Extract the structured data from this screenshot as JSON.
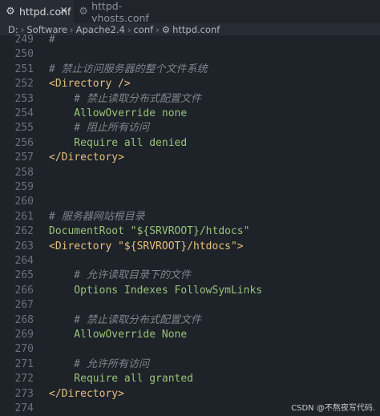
{
  "tabs": [
    {
      "label": "httpd.conf",
      "icon": "gear-icon",
      "active": true,
      "close": "×"
    },
    {
      "label": "httpd-vhosts.conf",
      "icon": "gear-icon",
      "active": false
    }
  ],
  "breadcrumb": {
    "parts": [
      "D:",
      "Software",
      "Apache2.4",
      "conf"
    ],
    "file": "httpd.conf",
    "separator": "›"
  },
  "editor": {
    "lines": [
      {
        "num": "249",
        "text": "#",
        "kind": "comment"
      },
      {
        "num": "250",
        "text": "",
        "kind": ""
      },
      {
        "num": "251",
        "text": "# 禁止访问服务器的整个文件系统",
        "kind": "comment"
      },
      {
        "num": "252",
        "text": "<Directory />",
        "kind": "tag"
      },
      {
        "num": "253",
        "text": "    # 禁止读取分布式配置文件",
        "kind": "comment"
      },
      {
        "num": "254",
        "text": "    AllowOverride none",
        "kind": "directive"
      },
      {
        "num": "255",
        "text": "    # 阻止所有访问",
        "kind": "comment"
      },
      {
        "num": "256",
        "text": "    Require all denied",
        "kind": "directive"
      },
      {
        "num": "257",
        "text": "</Directory>",
        "kind": "tag"
      },
      {
        "num": "258",
        "text": "",
        "kind": ""
      },
      {
        "num": "259",
        "text": "",
        "kind": ""
      },
      {
        "num": "260",
        "text": "",
        "kind": ""
      },
      {
        "num": "261",
        "text": "# 服务器网站根目录",
        "kind": "comment"
      },
      {
        "num": "262",
        "text": "DocumentRoot \"${SRVROOT}/htdocs\"",
        "kind": "string"
      },
      {
        "num": "263",
        "text": "<Directory \"${SRVROOT}/htdocs\">",
        "kind": "tag"
      },
      {
        "num": "264",
        "text": "",
        "kind": ""
      },
      {
        "num": "265",
        "text": "    # 允许读取目录下的文件",
        "kind": "comment"
      },
      {
        "num": "266",
        "text": "    Options Indexes FollowSymLinks",
        "kind": "directive"
      },
      {
        "num": "267",
        "text": "",
        "kind": ""
      },
      {
        "num": "268",
        "text": "    # 禁止读取分布式配置文件",
        "kind": "comment"
      },
      {
        "num": "269",
        "text": "    AllowOverride None",
        "kind": "directive"
      },
      {
        "num": "270",
        "text": "",
        "kind": ""
      },
      {
        "num": "271",
        "text": "    # 允许所有访问",
        "kind": "comment"
      },
      {
        "num": "272",
        "text": "    Require all granted",
        "kind": "directive"
      },
      {
        "num": "273",
        "text": "</Directory>",
        "kind": "tag"
      },
      {
        "num": "274",
        "text": "",
        "kind": ""
      }
    ]
  },
  "watermark": "CSDN @不熬夜写代码.",
  "colors": {
    "background": "#1e2229",
    "comment": "#7f848e",
    "tag": "#e5c07b",
    "directive": "#98c379",
    "line_number": "#6b717d"
  }
}
